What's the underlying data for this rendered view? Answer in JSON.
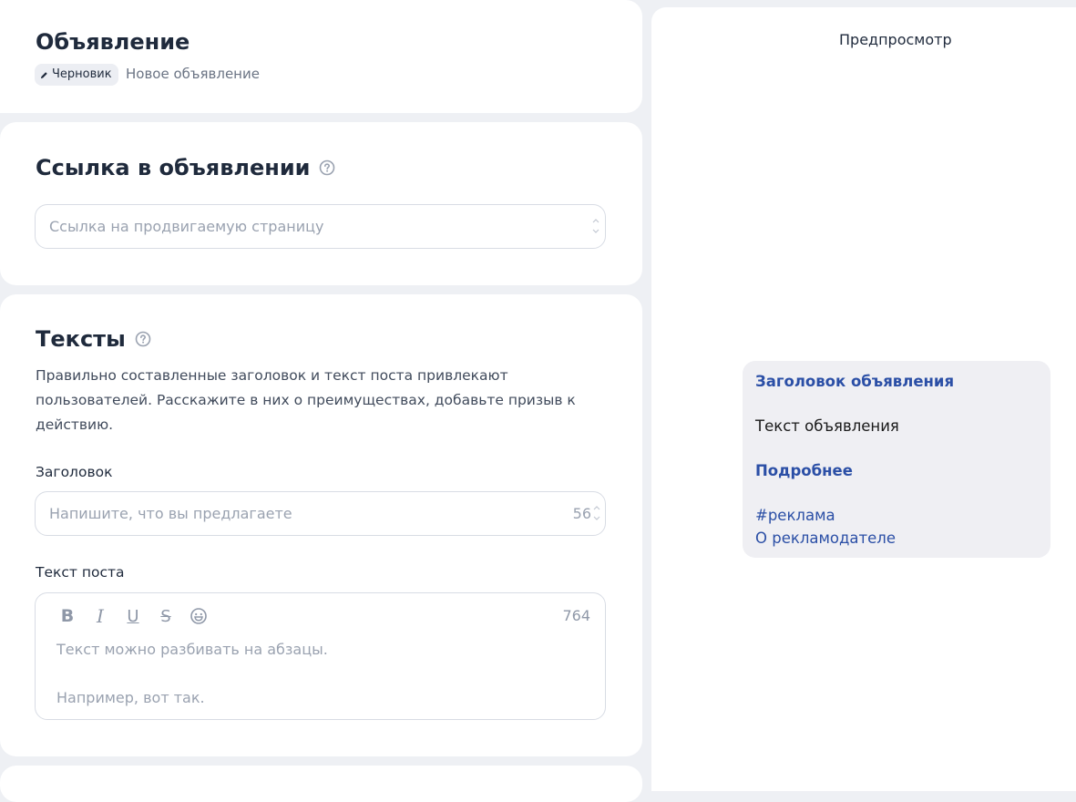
{
  "header": {
    "title": "Объявление",
    "status_badge": "Черновик",
    "subtitle": "Новое объявление"
  },
  "link_section": {
    "title": "Ссылка в объявлении",
    "input_placeholder": "Ссылка на продвигаемую страницу",
    "input_value": ""
  },
  "texts_section": {
    "title": "Тексты",
    "description": "Правильно составленные заголовок и текст поста привлекают пользователей. Расскажите в них о преимуществах, добавьте призыв к действию.",
    "headline_label": "Заголовок",
    "headline_placeholder": "Напишите, что вы предлагаете",
    "headline_counter": "56",
    "post_label": "Текст поста",
    "post_counter": "764",
    "post_placeholder_line1": "Текст можно разбивать на абзацы.",
    "post_placeholder_line2": "Например, вот так.",
    "toolbar": {
      "bold": "B",
      "italic": "I",
      "underline": "U",
      "strike": "S"
    }
  },
  "preview": {
    "title": "Предпросмотр",
    "headline": "Заголовок объявления",
    "text": "Текст объявления",
    "more": "Подробнее",
    "hashtag": "#реклама",
    "advertiser": "О рекламодателе"
  },
  "icons": {
    "badge": "pencil-icon",
    "help": "question-circle-icon",
    "emoji": "smile-icon",
    "spinner": "stepper-arrows-icon"
  },
  "colors": {
    "accent_link": "#2b4fa6",
    "page_bg": "#eef0f4",
    "card_bg": "#ffffff",
    "preview_card_bg": "#efeff3"
  }
}
